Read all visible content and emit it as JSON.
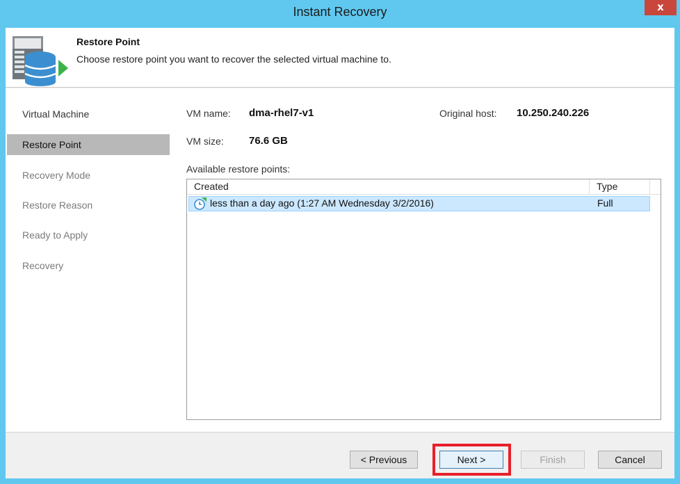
{
  "window": {
    "title": "Instant Recovery",
    "close_label": "x"
  },
  "header": {
    "title": "Restore Point",
    "description": "Choose restore point you want to recover the selected virtual machine to.",
    "icon": "database-restore-icon"
  },
  "sidebar": {
    "steps": [
      {
        "label": "Virtual Machine",
        "state": "done"
      },
      {
        "label": "Restore Point",
        "state": "active"
      },
      {
        "label": "Recovery Mode",
        "state": "pending"
      },
      {
        "label": "Restore Reason",
        "state": "pending"
      },
      {
        "label": "Ready to Apply",
        "state": "pending"
      },
      {
        "label": "Recovery",
        "state": "pending"
      }
    ]
  },
  "vm_info": {
    "name_label": "VM name:",
    "name_value": "dma-rhel7-v1",
    "host_label": "Original host:",
    "host_value": "10.250.240.226",
    "size_label": "VM size:",
    "size_value": "76.6 GB"
  },
  "restore_points": {
    "label": "Available restore points:",
    "columns": [
      "Created",
      "Type"
    ],
    "rows": [
      {
        "created": "less than a day ago (1:27 AM Wednesday 3/2/2016)",
        "type": "Full",
        "icon": "restore-point-clock-icon",
        "selected": true
      }
    ]
  },
  "footer": {
    "previous_label": "< Previous",
    "next_label": "Next >",
    "finish_label": "Finish",
    "cancel_label": "Cancel"
  },
  "colors": {
    "titlebar": "#60c8ef",
    "close_button": "#c9463d",
    "active_step": "#b8b8b8",
    "selected_row": "#cce8ff",
    "highlight": "#e8202a"
  }
}
